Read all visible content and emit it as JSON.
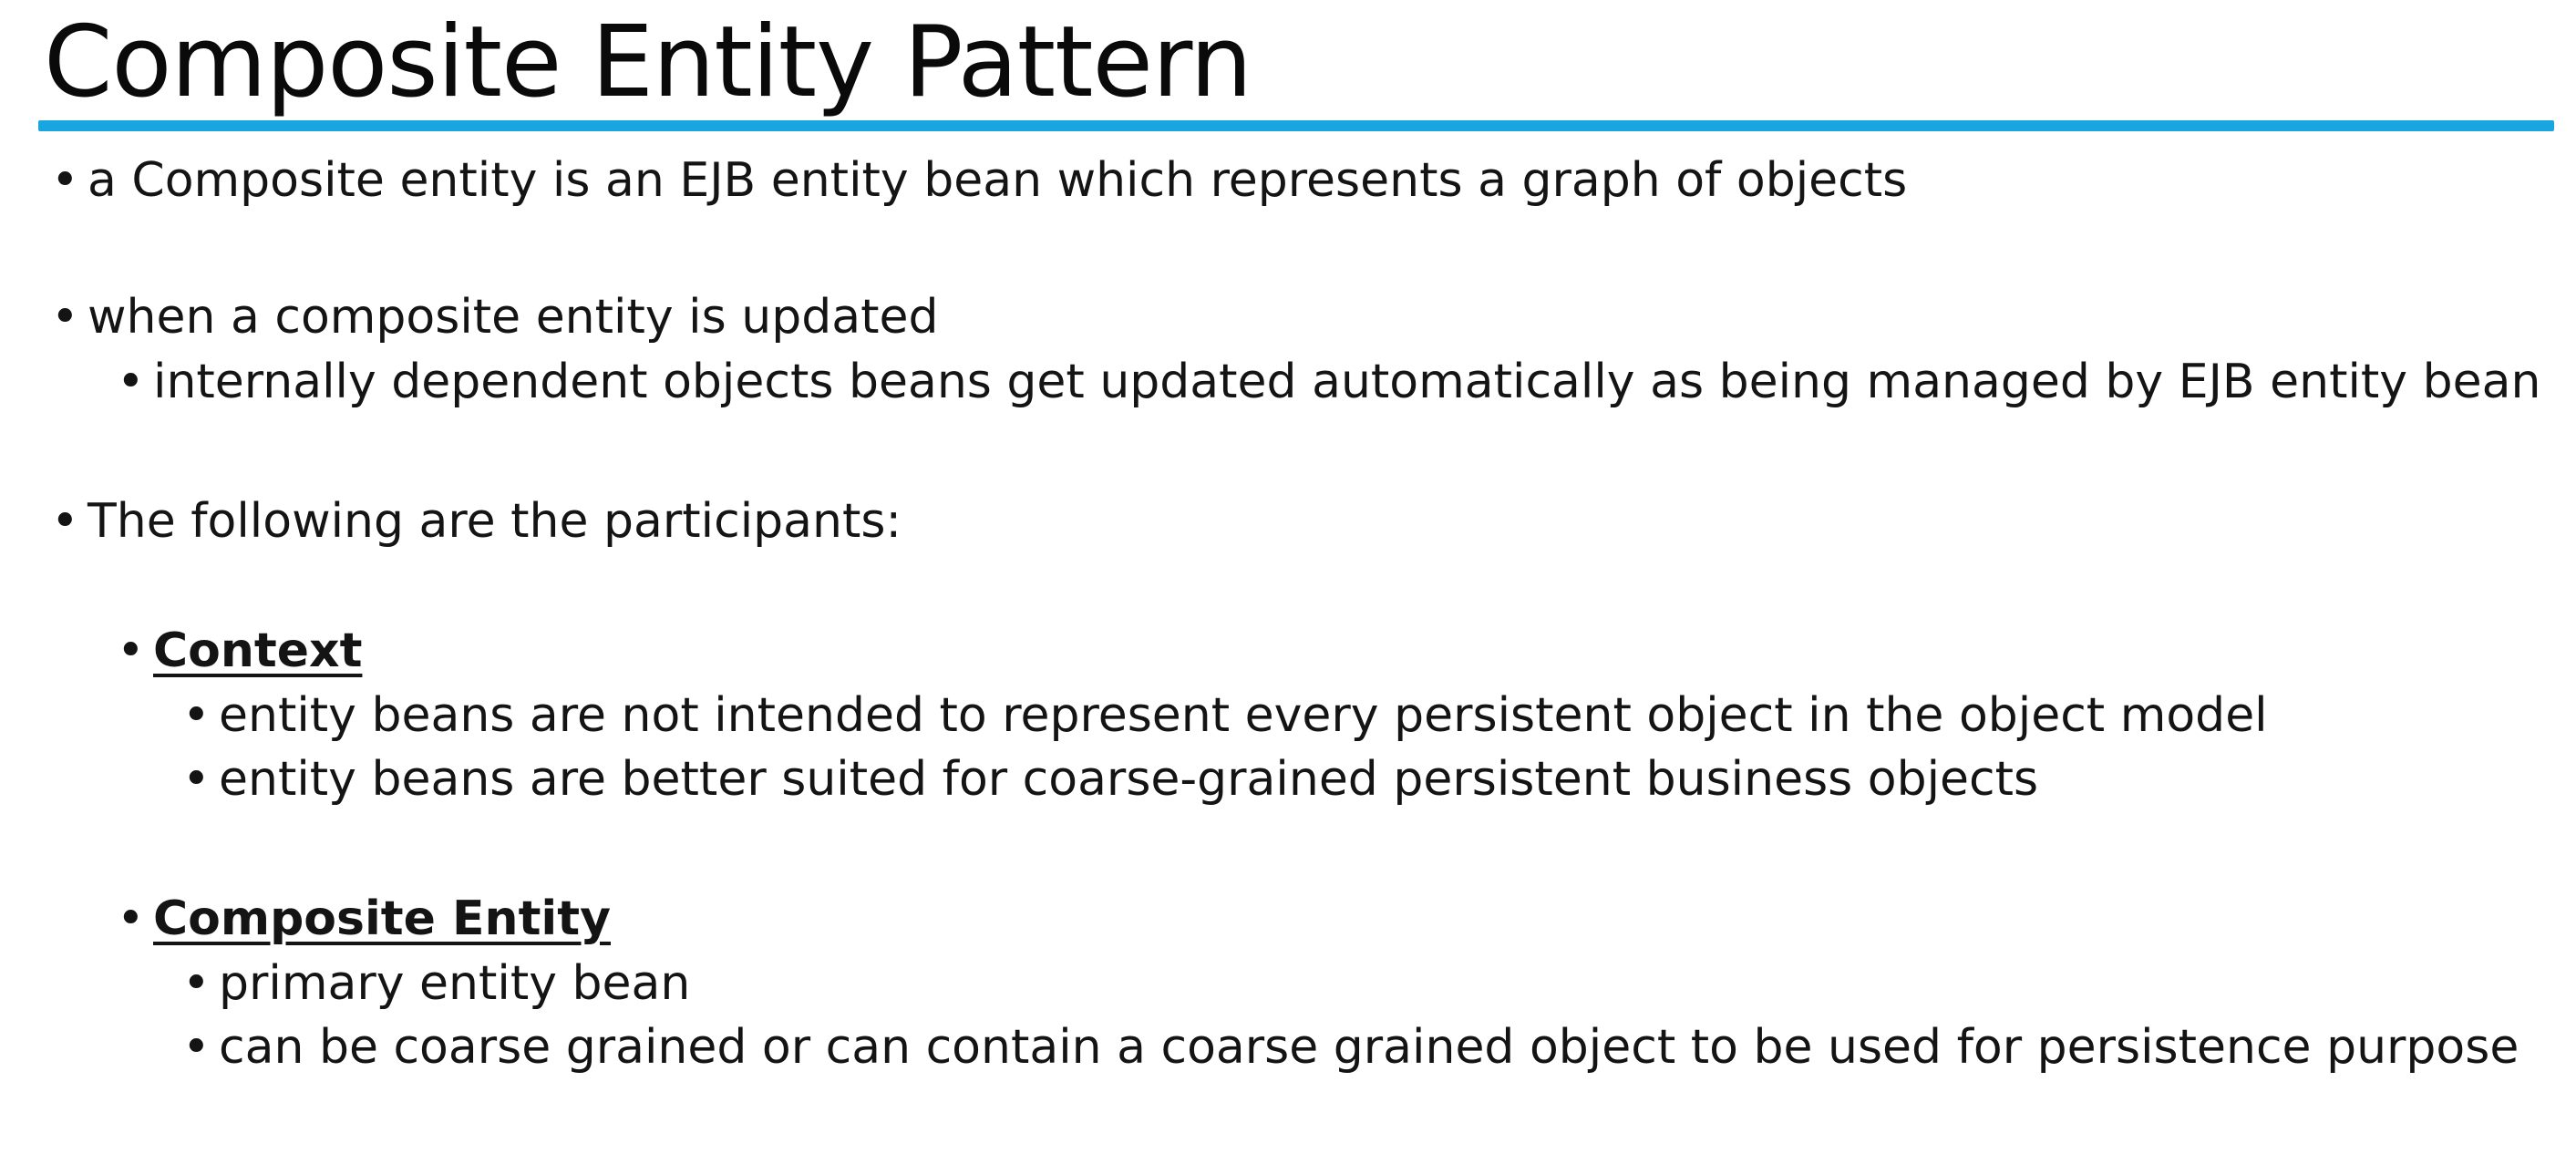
{
  "title": "Composite Entity Pattern",
  "colors": {
    "accent_rule": "#19a5e0",
    "text": "#141414"
  },
  "bullet_glyph": "•",
  "bullets": {
    "definition": "a Composite entity is an EJB entity bean which represents a graph of objects",
    "update": "when a composite entity is updated",
    "update_sub": "internally dependent objects beans get updated automatically as being managed by EJB entity bean",
    "participants": "The following are the participants:"
  },
  "context": {
    "heading": "Context",
    "items": [
      "entity beans are not intended to represent every persistent object in the object model",
      "entity beans are better suited for coarse-grained persistent business objects"
    ]
  },
  "composite_entity": {
    "heading": "Composite Entity",
    "items": [
      "primary entity bean",
      "can be coarse grained or can contain a coarse grained object to be used for persistence purpose"
    ]
  }
}
